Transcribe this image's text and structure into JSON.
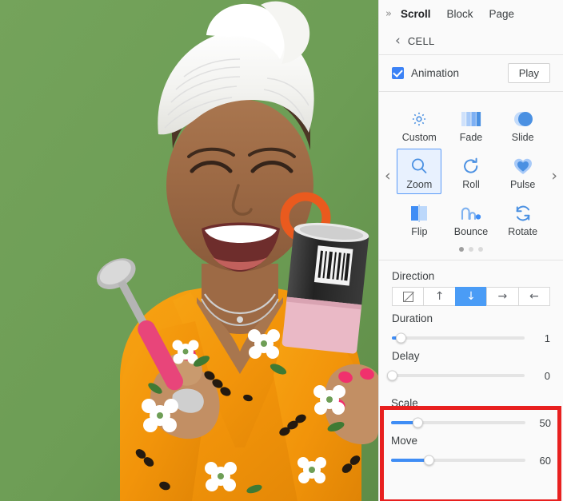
{
  "photo": {
    "alt": "woman-with-towel-turban-holding-ice-cream",
    "background_color": "#6e9e56",
    "robe_color": "#f59a0c",
    "earring_color": "#e8551c",
    "spoon_handle_color": "#e8457a",
    "cup_top_color": "#2b2b2b",
    "cup_bottom_color": "#e8b6c4"
  },
  "panel": {
    "collapse_icon": "»",
    "tabs": [
      {
        "label": "Scroll",
        "active": true
      },
      {
        "label": "Block",
        "active": false
      },
      {
        "label": "Page",
        "active": false
      }
    ],
    "breadcrumb": {
      "back_icon": "‹",
      "label": "CELL"
    },
    "animation": {
      "checkbox_checked": true,
      "label": "Animation",
      "play_label": "Play"
    },
    "effects": {
      "prev_icon": "‹",
      "next_icon": "›",
      "items": [
        {
          "label": "Custom",
          "icon": "gear-icon",
          "selected": false
        },
        {
          "label": "Fade",
          "icon": "fade-bars-icon",
          "selected": false
        },
        {
          "label": "Slide",
          "icon": "slide-circle-icon",
          "selected": false
        },
        {
          "label": "Zoom",
          "icon": "magnifier-icon",
          "selected": true
        },
        {
          "label": "Roll",
          "icon": "roll-arrow-icon",
          "selected": false
        },
        {
          "label": "Pulse",
          "icon": "heart-icon",
          "selected": false
        },
        {
          "label": "Flip",
          "icon": "flip-bars-icon",
          "selected": false
        },
        {
          "label": "Bounce",
          "icon": "bounce-arc-icon",
          "selected": false
        },
        {
          "label": "Rotate",
          "icon": "rotate-arrows-icon",
          "selected": false
        }
      ],
      "pager": {
        "count": 3,
        "active_index": 0
      }
    },
    "options": {
      "direction": {
        "label": "Direction",
        "buttons": [
          {
            "icon": "none-slash-icon",
            "selected": false
          },
          {
            "icon": "arrow-up-icon",
            "glyph": "↑",
            "selected": false
          },
          {
            "icon": "arrow-down-icon",
            "glyph": "↓",
            "selected": true
          },
          {
            "icon": "arrow-right-icon",
            "glyph": "→",
            "selected": false
          },
          {
            "icon": "arrow-left-icon",
            "glyph": "←",
            "selected": false
          }
        ]
      },
      "sliders": [
        {
          "label": "Duration",
          "value": "1",
          "percent": 7,
          "highlighted": false
        },
        {
          "label": "Delay",
          "value": "0",
          "percent": 0,
          "highlighted": false
        },
        {
          "label": "Scale",
          "value": "50",
          "percent": 20,
          "highlighted": true
        },
        {
          "label": "Move",
          "value": "60",
          "percent": 28,
          "highlighted": true
        }
      ]
    },
    "highlight_color": "#e8201f",
    "accent_color": "#3f8df5"
  }
}
